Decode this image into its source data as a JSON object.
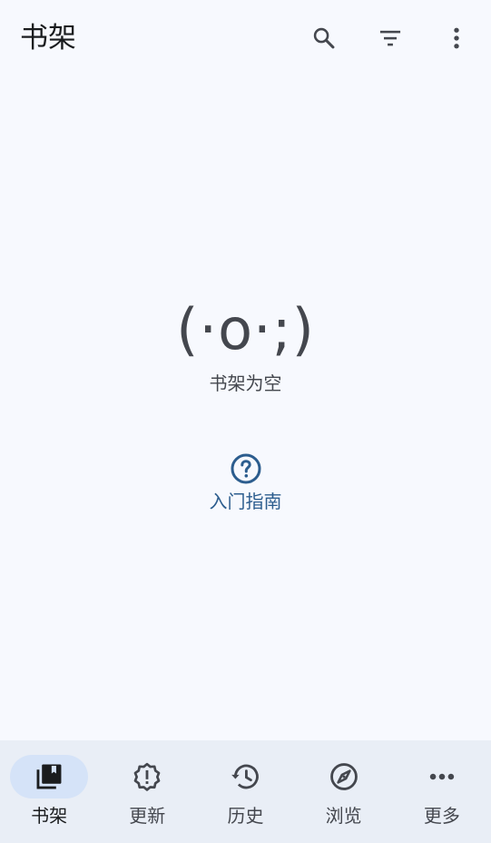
{
  "topbar": {
    "title": "书架",
    "actions": [
      {
        "name": "search",
        "icon": "search-icon"
      },
      {
        "name": "filter",
        "icon": "filter-icon"
      },
      {
        "name": "more",
        "icon": "more-vert-icon"
      }
    ]
  },
  "empty_state": {
    "kaomoji": "(·o·;)",
    "message": "书架为空"
  },
  "guide": {
    "icon": "help-circle-icon",
    "label": "入门指南"
  },
  "bottom_nav": {
    "active_index": 0,
    "items": [
      {
        "label": "书架",
        "icon": "library-icon"
      },
      {
        "label": "更新",
        "icon": "updates-alert-icon"
      },
      {
        "label": "历史",
        "icon": "history-icon"
      },
      {
        "label": "浏览",
        "icon": "explore-compass-icon"
      },
      {
        "label": "更多",
        "icon": "more-horiz-icon"
      }
    ]
  },
  "colors": {
    "background": "#f7f9fe",
    "nav_background": "#e9eef6",
    "active_pill": "#d5e3f8",
    "primary": "#2c5d8e",
    "on_surface": "#1a1c1e",
    "on_surface_variant": "#44474e"
  }
}
